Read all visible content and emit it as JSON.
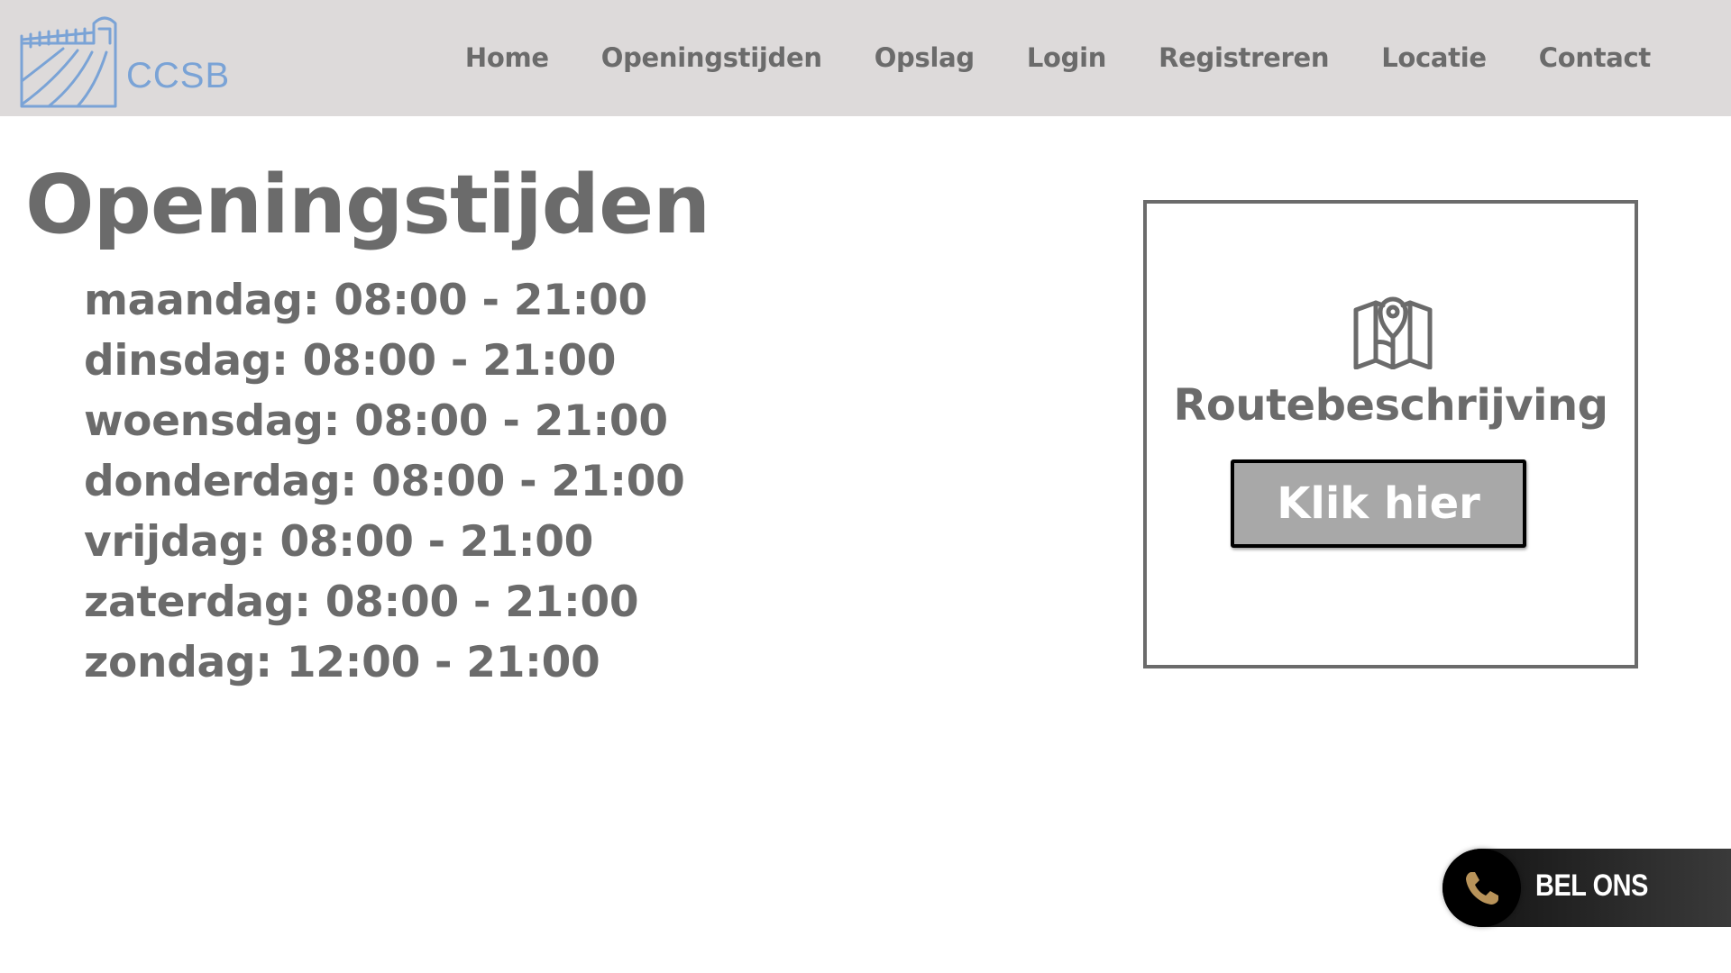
{
  "header": {
    "logo_text": "CCSB",
    "logo_icon": "farm-field-gate-logo",
    "nav": [
      {
        "label": "Home"
      },
      {
        "label": "Openingstijden"
      },
      {
        "label": "Opslag"
      },
      {
        "label": "Login"
      },
      {
        "label": "Registreren"
      },
      {
        "label": "Locatie"
      },
      {
        "label": "Contact"
      }
    ]
  },
  "main": {
    "title": "Openingstijden",
    "hours": [
      "maandag: 08:00 - 21:00",
      "dinsdag: 08:00 - 21:00",
      "woensdag: 08:00 - 21:00",
      "donderdag: 08:00 - 21:00",
      "vrijdag: 08:00 - 21:00",
      "zaterdag: 08:00 - 21:00",
      "zondag: 12:00 - 21:00"
    ]
  },
  "route_card": {
    "icon": "map-pin-icon",
    "title": "Routebeschrijving",
    "button_label": "Klik hier"
  },
  "call": {
    "icon": "phone-icon",
    "label": "BEL ONS"
  },
  "colors": {
    "header_bg": "#dddada",
    "text": "#6b6b6b",
    "logo": "#7aa3d6",
    "button_bg": "#a8a8a8",
    "phone_icon": "#b8935a"
  }
}
